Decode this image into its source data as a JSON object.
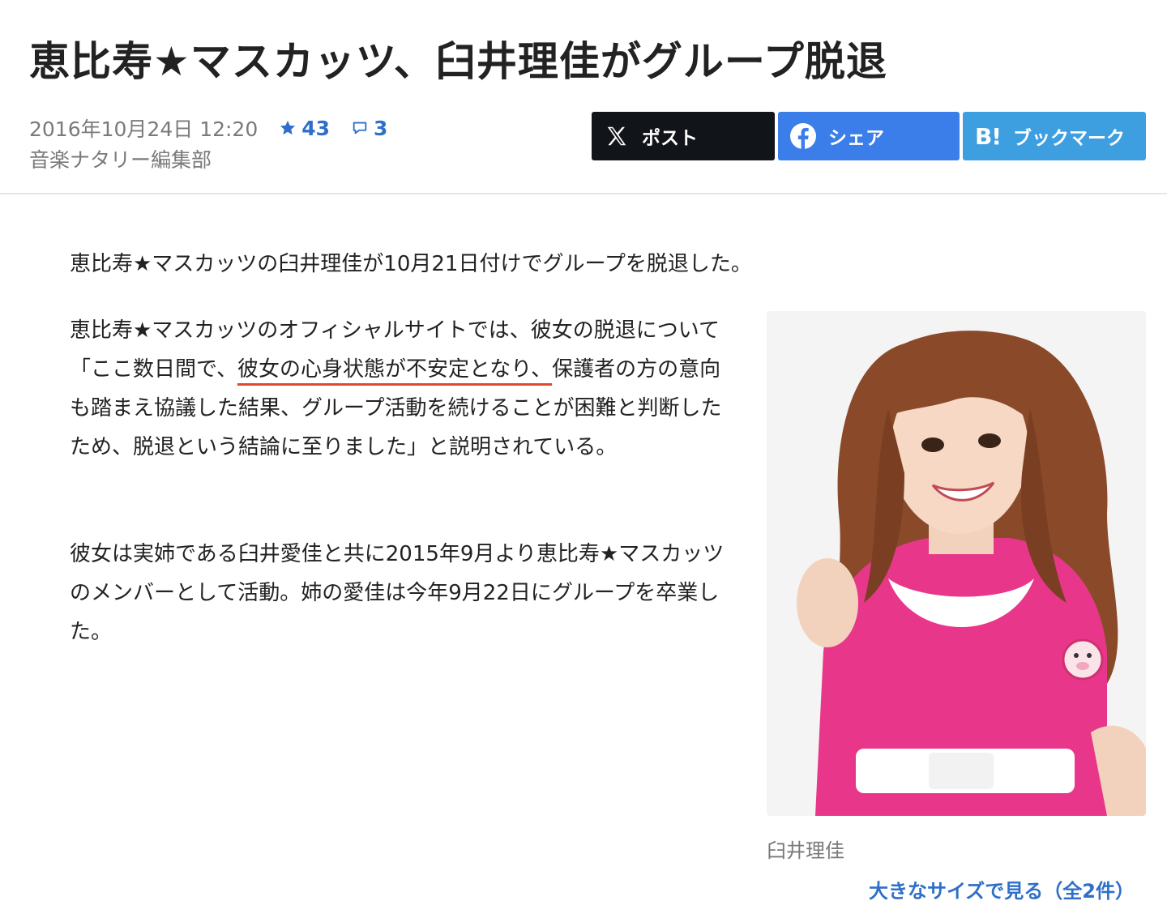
{
  "article": {
    "title": "恵比寿★マスカッツ、臼井理佳がグループ脱退",
    "date": "2016年10月24日 12:20",
    "stars": "43",
    "comments": "3",
    "author": "音楽ナタリー編集部"
  },
  "share": {
    "x_label": "ポスト",
    "facebook_label": "シェア",
    "hatena_mark": "B!",
    "hatena_label": "ブックマーク"
  },
  "body": {
    "p1": "恵比寿★マスカッツの臼井理佳が10月21日付けでグループを脱退した。",
    "p2_before": "恵比寿★マスカッツのオフィシャルサイトでは、彼女の脱退について「ここ数日間で、",
    "p2_highlight": "彼女の心身状態が不安定となり、",
    "p2_after": "保護者の方の意向も踏まえ協議した結果、グループ活動を続けることが困難と判断したため、脱退という結論に至りました」と説明されている。",
    "p3": "彼女は実姉である臼井愛佳と共に2015年9月より恵比寿★マスカッツのメンバーとして活動。姉の愛佳は今年9月22日にグループを卒業した。"
  },
  "photo": {
    "caption": "臼井理佳",
    "more_link": "大きなサイズで見る（全2件）"
  },
  "colors": {
    "accent_blue": "#2f6fc8",
    "x_bg": "#111418",
    "facebook_bg": "#3b7de9",
    "hatena_bg": "#3d9ee0",
    "highlight_underline": "#e04a2a",
    "dress_pink": "#e8378a"
  }
}
